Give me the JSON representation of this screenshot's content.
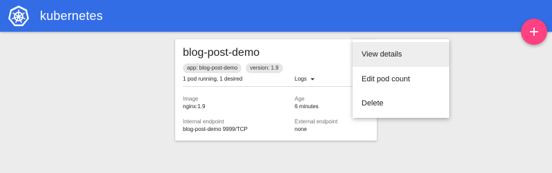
{
  "header": {
    "brand": "kubernetes",
    "logo_icon": "kubernetes-helm-icon",
    "bg_color": "#326de6"
  },
  "fab": {
    "icon": "plus-icon",
    "color": "#ff4081",
    "label": "+"
  },
  "card": {
    "title": "blog-post-demo",
    "labels": [
      "app: blog-post-demo",
      "version: 1.9"
    ],
    "status": "1 pod running, 1 desired",
    "logs_label": "Logs",
    "fields": {
      "image_label": "Image",
      "image_value": "nginx:1.9",
      "age_label": "Age",
      "age_value": "6 minutes",
      "internal_label": "Internal endpoint",
      "internal_value": "blog-post-demo 9999/TCP",
      "external_label": "External endpoint",
      "external_value": "none"
    }
  },
  "menu": {
    "items": [
      "View details",
      "Edit pod count",
      "Delete"
    ],
    "active_index": 0
  }
}
